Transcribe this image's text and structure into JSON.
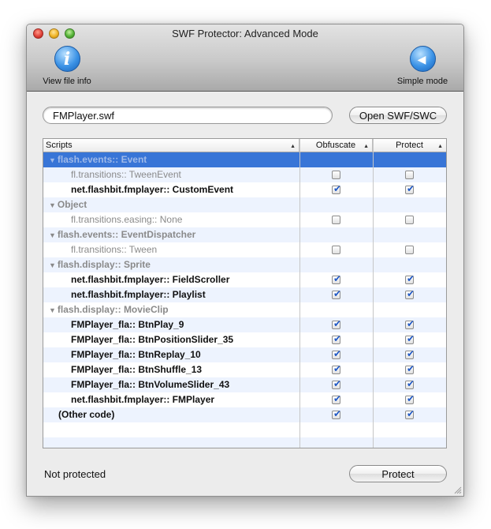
{
  "window": {
    "title": "SWF Protector:  Advanced Mode"
  },
  "toolbar": {
    "view_file_info_label": "View file info",
    "view_file_info_icon": "info-icon",
    "simple_mode_label": "Simple mode",
    "simple_mode_icon": "back-arrow-icon"
  },
  "file": {
    "value": "FMPlayer.swf",
    "open_label": "Open SWF/SWC"
  },
  "table": {
    "columns": [
      "Scripts",
      "Obfuscate",
      "Protect"
    ],
    "rows": [
      {
        "type": "group",
        "label": "flash.events:: Event",
        "selected": true
      },
      {
        "type": "item",
        "label": "fl.transitions:: TweenEvent",
        "active": false,
        "obfuscate": false,
        "protect": false
      },
      {
        "type": "item",
        "label": "net.flashbit.fmplayer:: CustomEvent",
        "active": true,
        "obfuscate": true,
        "protect": true
      },
      {
        "type": "group",
        "label": "Object"
      },
      {
        "type": "item",
        "label": "fl.transitions.easing:: None",
        "active": false,
        "obfuscate": false,
        "protect": false
      },
      {
        "type": "group",
        "label": "flash.events:: EventDispatcher"
      },
      {
        "type": "item",
        "label": "fl.transitions:: Tween",
        "active": false,
        "obfuscate": false,
        "protect": false
      },
      {
        "type": "group",
        "label": "flash.display:: Sprite"
      },
      {
        "type": "item",
        "label": "net.flashbit.fmplayer:: FieldScroller",
        "active": true,
        "obfuscate": true,
        "protect": true
      },
      {
        "type": "item",
        "label": "net.flashbit.fmplayer:: Playlist",
        "active": true,
        "obfuscate": true,
        "protect": true
      },
      {
        "type": "group",
        "label": "flash.display:: MovieClip"
      },
      {
        "type": "item",
        "label": "FMPlayer_fla:: BtnPlay_9",
        "active": true,
        "obfuscate": true,
        "protect": true
      },
      {
        "type": "item",
        "label": "FMPlayer_fla:: BtnPositionSlider_35",
        "active": true,
        "obfuscate": true,
        "protect": true
      },
      {
        "type": "item",
        "label": "FMPlayer_fla:: BtnReplay_10",
        "active": true,
        "obfuscate": true,
        "protect": true
      },
      {
        "type": "item",
        "label": "FMPlayer_fla:: BtnShuffle_13",
        "active": true,
        "obfuscate": true,
        "protect": true
      },
      {
        "type": "item",
        "label": "FMPlayer_fla:: BtnVolumeSlider_43",
        "active": true,
        "obfuscate": true,
        "protect": true
      },
      {
        "type": "item",
        "label": "net.flashbit.fmplayer:: FMPlayer",
        "active": true,
        "obfuscate": true,
        "protect": true
      },
      {
        "type": "other",
        "label": "(Other code)",
        "active": true,
        "obfuscate": true,
        "protect": true
      }
    ],
    "empty_rows": 2
  },
  "status": {
    "text": "Not protected"
  },
  "actions": {
    "protect_label": "Protect"
  },
  "colors": {
    "selection": "#3875d7",
    "alternate_row": "#edf3fe",
    "checkmark": "#1f58c5"
  }
}
